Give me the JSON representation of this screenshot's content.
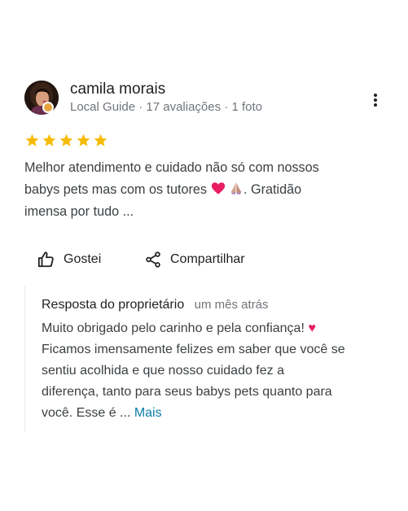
{
  "reviewer": {
    "name": "camila morais",
    "meta": "Local Guide · 17 avaliações · 1 foto",
    "avatar_icon": "profile-photo",
    "badge_icon": "local-guide-badge"
  },
  "rating": {
    "value": 5,
    "max": 5,
    "star_color": "#f6bb06"
  },
  "review": {
    "text_line1": "Melhor atendimento e cuidado não só com nossos",
    "text_line2_a": "babys pets mas com os tutores ",
    "text_line2_b": ". Gratidão",
    "text_line3": "imensa por tudo ..."
  },
  "actions": {
    "like_label": "Gostei",
    "share_label": "Compartilhar",
    "like_icon": "thumbs-up-icon",
    "share_icon": "share-icon"
  },
  "owner_reply": {
    "title": "Resposta do proprietário",
    "time": "um mês atrás",
    "line1": "Muito obrigado pelo carinho e pela confiança! ",
    "line2": "Ficamos imensamente felizes em saber que você se",
    "line3": "sentiu acolhida e que nosso cuidado fez a",
    "line4": "diferença, tanto para seus babys pets quanto para",
    "line5": "você. Esse é ... ",
    "more_label": "Mais"
  },
  "colors": {
    "link": "#0b7ea8",
    "heart": "#e91e63",
    "secondary_text": "#70757a"
  }
}
